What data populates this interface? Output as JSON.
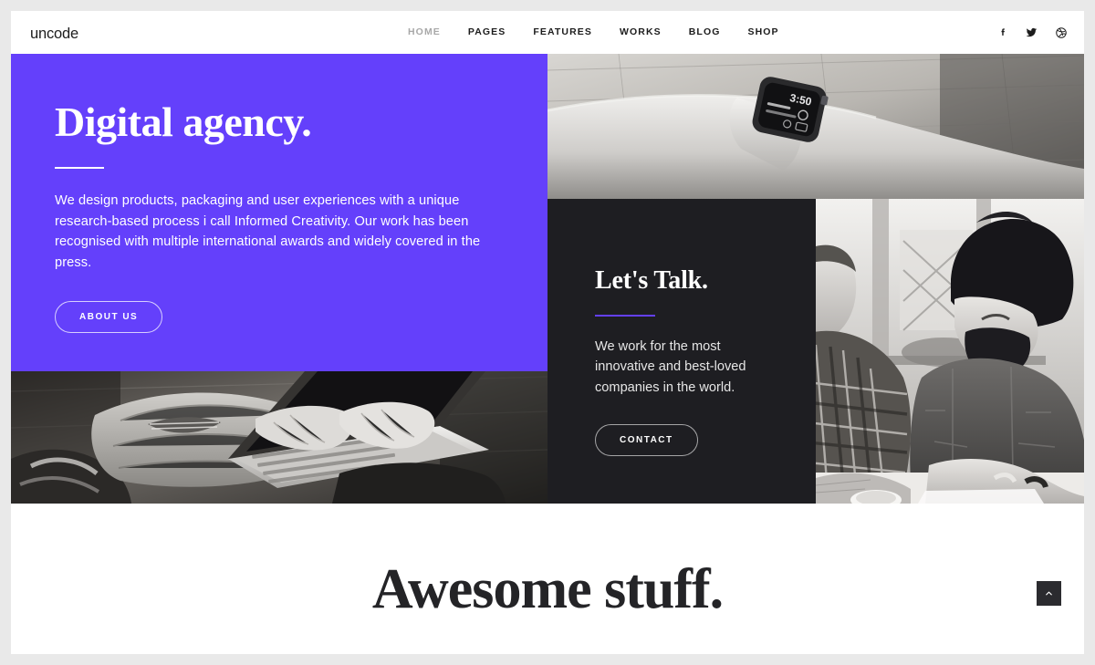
{
  "site": {
    "brand": "uncode",
    "accent_color": "#6440fb",
    "dark_panel_color": "#1e1e22",
    "text_dark": "#1c1c1c"
  },
  "header": {
    "nav": [
      {
        "label": "HOME",
        "active": true
      },
      {
        "label": "PAGES",
        "active": false
      },
      {
        "label": "FEATURES",
        "active": false
      },
      {
        "label": "WORKS",
        "active": false
      },
      {
        "label": "BLOG",
        "active": false
      },
      {
        "label": "SHOP",
        "active": false
      }
    ],
    "social": [
      {
        "name": "facebook-icon",
        "label": "Facebook"
      },
      {
        "name": "twitter-icon",
        "label": "Twitter"
      },
      {
        "name": "dribbble-icon",
        "label": "Dribbble"
      }
    ]
  },
  "hero": {
    "intro": {
      "title": "Digital agency.",
      "paragraph": "We design products, packaging and user experiences with a unique research-based process i call Informed Creativity. Our work has been recognised with multiple international awards and widely covered in the press.",
      "button_label": "ABOUT US"
    },
    "talk": {
      "title": "Let's Talk.",
      "paragraph": "We work for the most innovative and best-loved companies in the world.",
      "button_label": "CONTACT"
    },
    "photos": {
      "watch": "grayscale photo of a smartwatch on a wrist resting on a wooden table",
      "people": "grayscale photo of two people in flannel and denim working at a desk",
      "laptop": "grayscale photo of a person typing on a laptop seated on the floor"
    }
  },
  "bottom": {
    "title": "Awesome stuff."
  },
  "back_to_top": {
    "icon": "chevron-up-icon",
    "label": "Back to top"
  }
}
